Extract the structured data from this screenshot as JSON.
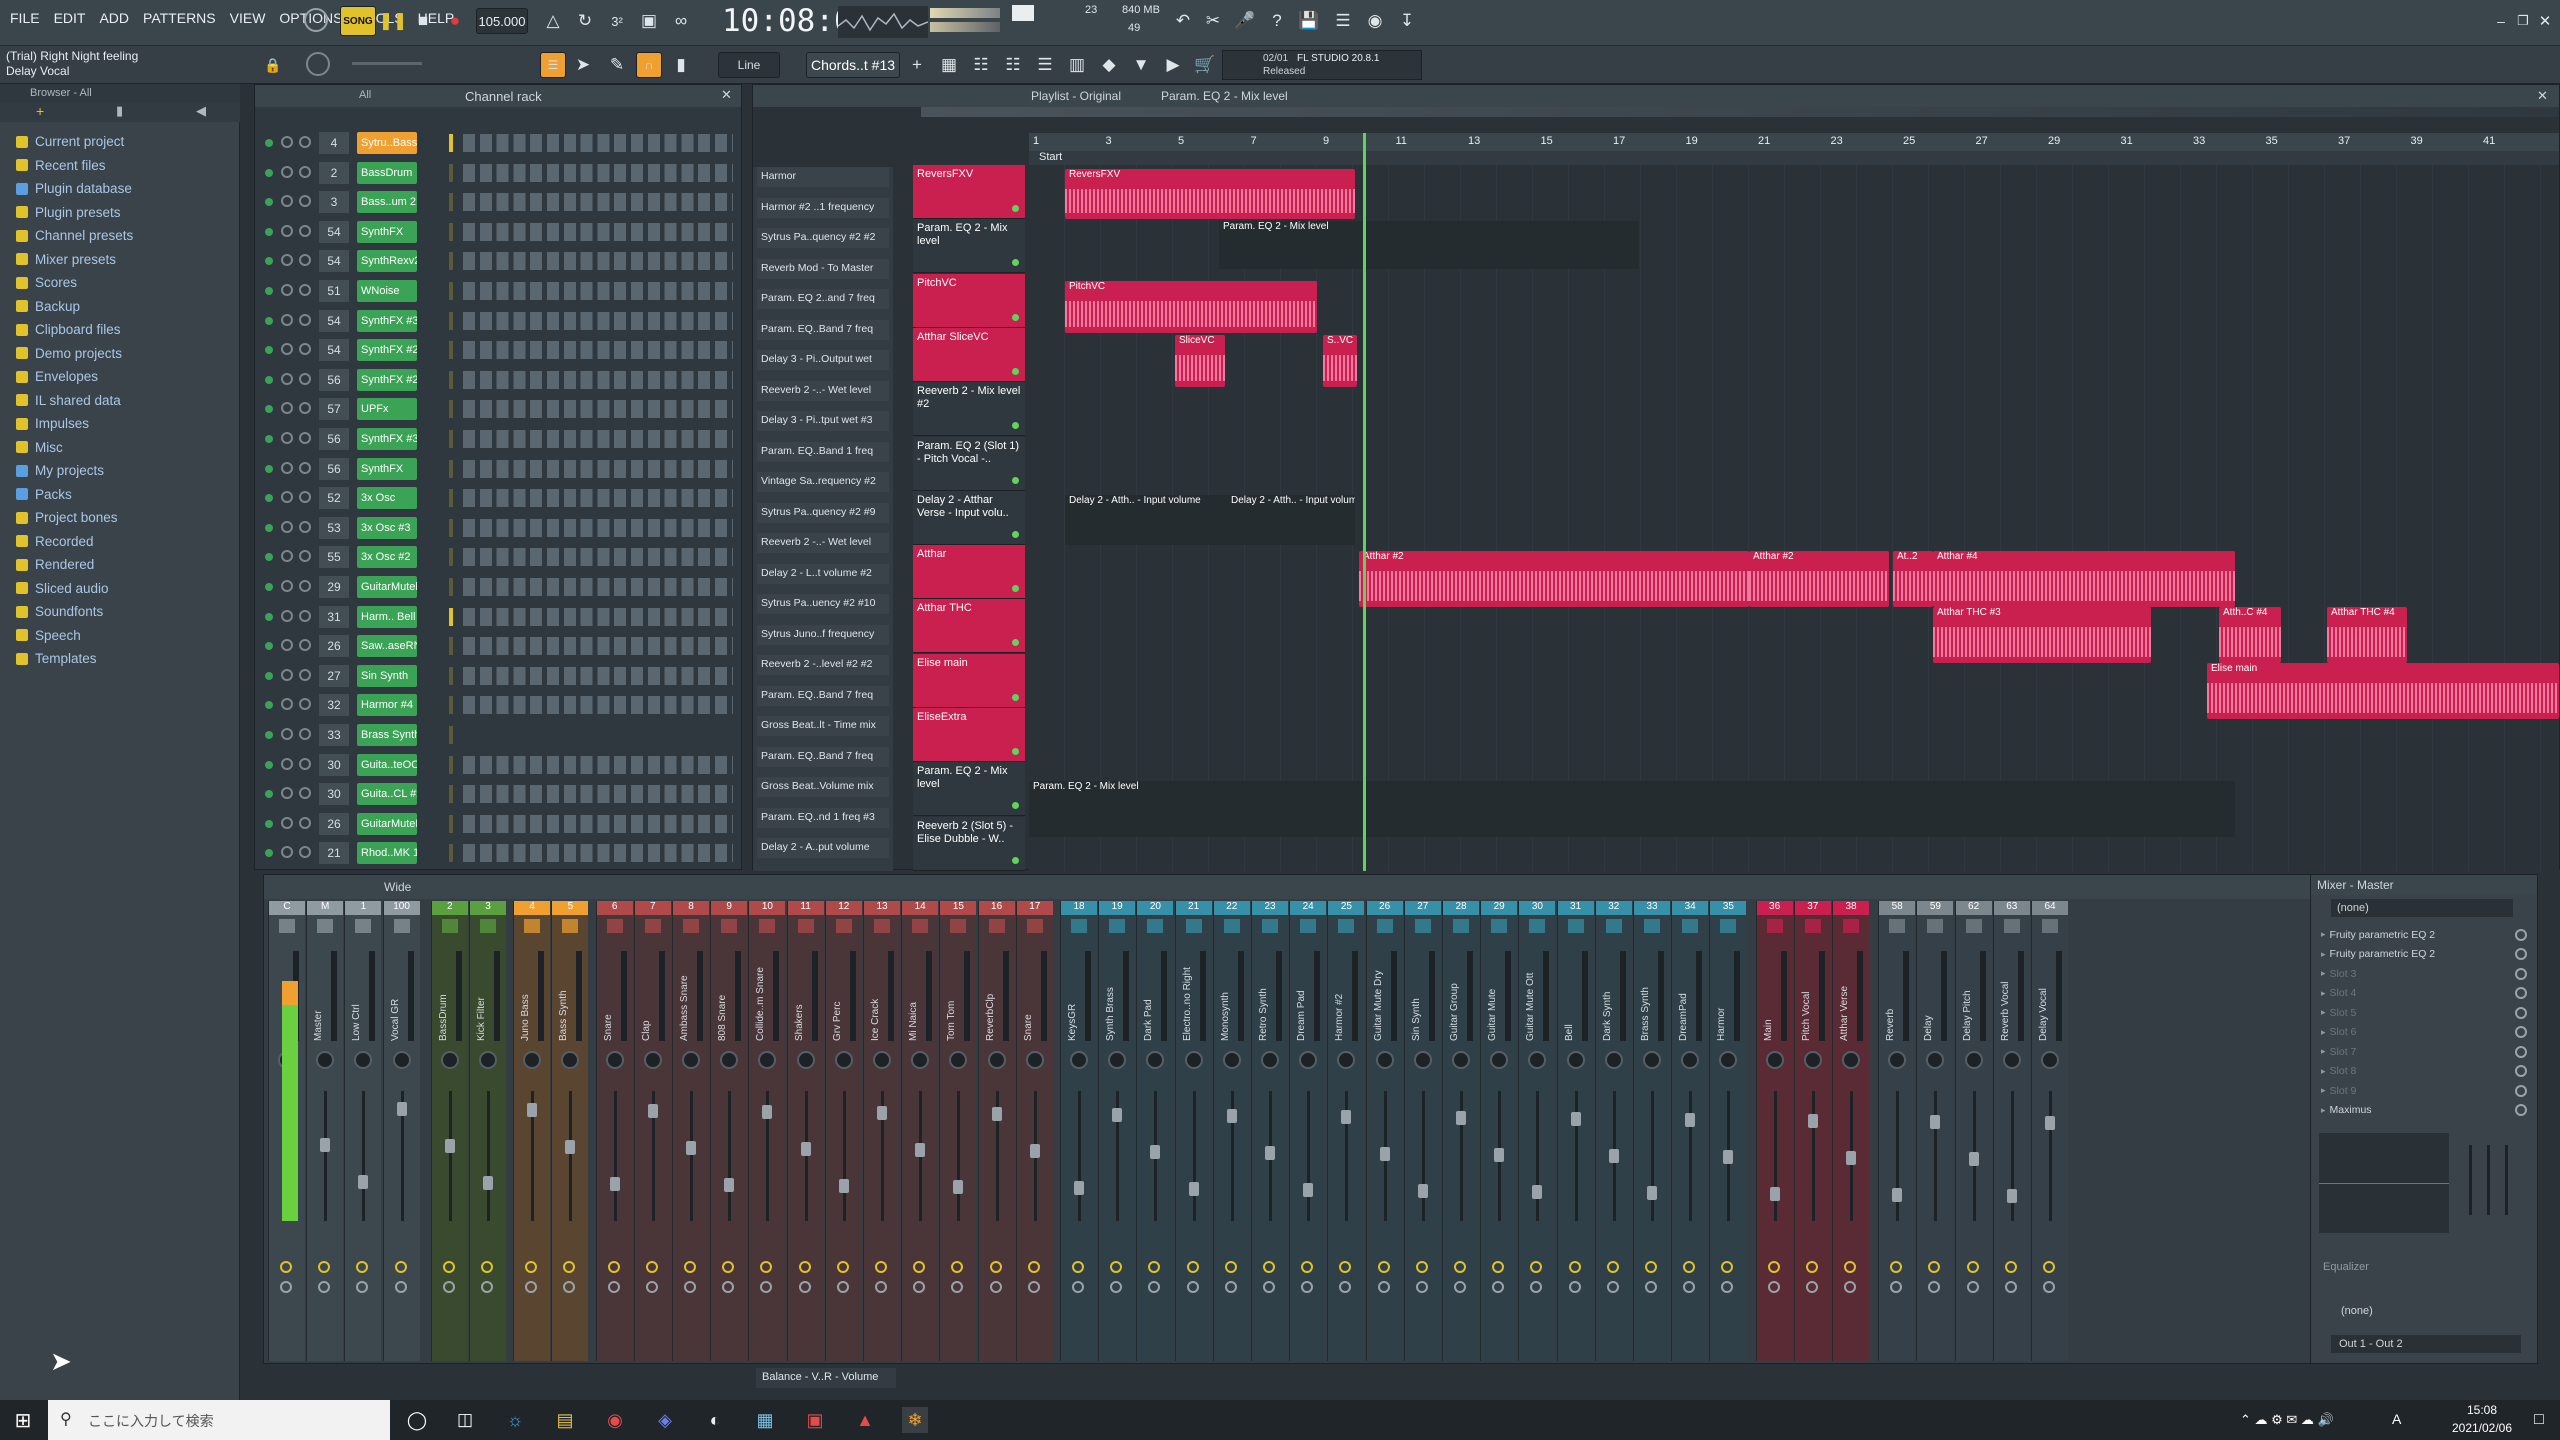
{
  "menu": [
    "FILE",
    "EDIT",
    "ADD",
    "PATTERNS",
    "VIEW",
    "OPTIONS",
    "TOOLS",
    "HELP"
  ],
  "transport": {
    "mode": "SONG",
    "tempo": "105.000",
    "time": "10:08:03",
    "cpu": "23",
    "memory": "840 MB",
    "polyphony": "49"
  },
  "hint": {
    "line1": "(Trial) Right Night feeling",
    "line2": "Delay Vocal"
  },
  "toolbar": {
    "snap": "Line",
    "pattern": "Chords..t #13",
    "news_date": "02/01",
    "news_title": "FL STUDIO 20.8.1",
    "news_sub": "Released"
  },
  "browser": {
    "title": "Browser - All",
    "items": [
      "Current project",
      "Recent files",
      "Plugin database",
      "Plugin presets",
      "Channel presets",
      "Mixer presets",
      "Scores",
      "Backup",
      "Clipboard files",
      "Demo projects",
      "Envelopes",
      "IL shared data",
      "Impulses",
      "Misc",
      "My projects",
      "Packs",
      "Project bones",
      "Recorded",
      "Rendered",
      "Sliced audio",
      "Soundfonts",
      "Speech",
      "Templates"
    ]
  },
  "rack": {
    "title": "Channel rack",
    "filter": "All",
    "channels": [
      {
        "num": "4",
        "name": "Sytru..Bass #4"
      },
      {
        "num": "2",
        "name": "BassDrum"
      },
      {
        "num": "3",
        "name": "Bass..um 2"
      },
      {
        "num": "54",
        "name": "SynthFX"
      },
      {
        "num": "54",
        "name": "SynthRexv2"
      },
      {
        "num": "51",
        "name": "WNoise"
      },
      {
        "num": "54",
        "name": "SynthFX #3"
      },
      {
        "num": "54",
        "name": "SynthFX #2"
      },
      {
        "num": "56",
        "name": "SynthFX #2"
      },
      {
        "num": "57",
        "name": "UPFx"
      },
      {
        "num": "56",
        "name": "SynthFX #3"
      },
      {
        "num": "56",
        "name": "SynthFX"
      },
      {
        "num": "52",
        "name": "3x Osc"
      },
      {
        "num": "53",
        "name": "3x Osc #3"
      },
      {
        "num": "55",
        "name": "3x Osc #2"
      },
      {
        "num": "29",
        "name": "GuitarMutel"
      },
      {
        "num": "31",
        "name": "Harm.. Bell"
      },
      {
        "num": "26",
        "name": "Saw..aseRN"
      },
      {
        "num": "27",
        "name": "Sin Synth"
      },
      {
        "num": "32",
        "name": "Harmor #4"
      },
      {
        "num": "33",
        "name": "Brass Synth"
      },
      {
        "num": "30",
        "name": "Guita..teOCL"
      },
      {
        "num": "30",
        "name": "Guita..CL #2"
      },
      {
        "num": "26",
        "name": "GuitarMuteR"
      },
      {
        "num": "21",
        "name": "Rhod..MK 1"
      }
    ]
  },
  "playlist": {
    "title": "Playlist - Original",
    "subtitle": "Param. EQ 2 - Mix level",
    "start_marker": "Start",
    "bar_numbers": [
      "1",
      "3",
      "5",
      "7",
      "9",
      "11",
      "13",
      "15",
      "17",
      "19",
      "21",
      "23",
      "25",
      "27",
      "29",
      "31",
      "33",
      "35",
      "37",
      "39",
      "41"
    ],
    "picker": [
      "Harmor",
      "Harmor #2 ..1 frequency",
      "Sytrus Pa..quency #2 #2",
      "Reverb Mod - To Master",
      "Param. EQ 2..and 7 freq",
      "Param. EQ..Band 7 freq",
      "Delay 3 - Pi..Output wet",
      "Reeverb 2 -..- Wet level",
      "Delay 3 - Pi..tput wet #3",
      "Param. EQ..Band 1 freq",
      "Vintage Sa..requency #2",
      "Sytrus Pa..quency #2 #9",
      "Reeverb 2 -..- Wet level",
      "Delay 2 - L..t volume #2",
      "Sytrus Pa..uency #2 #10",
      "Sytrus Juno..f frequency",
      "Reeverb 2 -..level #2 #2",
      "Param. EQ..Band 7 freq",
      "Gross Beat..lt - Time mix",
      "Param. EQ..Band 7 freq",
      "Gross Beat..Volume mix",
      "Param. EQ..nd 1 freq #3",
      "Delay 2 - A..put volume",
      "Balance - V..R - Volume"
    ],
    "tracks": [
      {
        "name": "ReversFXV"
      },
      {
        "name": "Param. EQ 2 - Mix level"
      },
      {
        "name": "PitchVC"
      },
      {
        "name": "Atthar SliceVC"
      },
      {
        "name": "Reeverb 2 - Mix level #2"
      },
      {
        "name": "Param. EQ 2 (Slot 1) - Pitch Vocal -.."
      },
      {
        "name": "Delay 2 - Atthar Verse - Input volu.."
      },
      {
        "name": "Atthar"
      },
      {
        "name": "Atthar THC"
      },
      {
        "name": "Elise main"
      },
      {
        "name": "EliseExtra"
      },
      {
        "name": "Param. EQ 2 - Mix level"
      },
      {
        "name": "Reeverb 2 (Slot 5) - Elise Dubble - W.."
      }
    ],
    "clips": {
      "c1": "ReversFXV",
      "c2": "Param. EQ 2 - Mix level",
      "c3": "PitchVC",
      "c4": "SliceVC",
      "c5": "S..VC",
      "c6": "Delay 2 - Atth.. - Input volume",
      "c7": "Delay 2 - Atth.. - Input volume",
      "c8": "Atthar #2",
      "c9": "Atthar #2",
      "c10": "At..2",
      "c11": "Atthar #4",
      "c12": "Atthar THC #3",
      "c13": "Atth..C #4",
      "c14": "Atthar THC #4",
      "c15": "Elise main",
      "c16": "Param. EQ 2 - Mix level"
    }
  },
  "mixer": {
    "title": "Mixer - Master",
    "width_mode": "Wide",
    "strips": [
      {
        "num": "C",
        "name": ""
      },
      {
        "num": "M",
        "name": "Master"
      },
      {
        "num": "1",
        "name": "Low Ctrl"
      },
      {
        "num": "100",
        "name": "Vocal GR"
      },
      {
        "num": "2",
        "name": "BassDrum"
      },
      {
        "num": "3",
        "name": "Kick Filter"
      },
      {
        "num": "4",
        "name": "Juno Bass"
      },
      {
        "num": "5",
        "name": "Bass Synth"
      },
      {
        "num": "6",
        "name": "Snare"
      },
      {
        "num": "7",
        "name": "Clap"
      },
      {
        "num": "8",
        "name": "Ambass Snare"
      },
      {
        "num": "9",
        "name": "808 Snare"
      },
      {
        "num": "10",
        "name": "Collide..m Snare"
      },
      {
        "num": "11",
        "name": "Shakers"
      },
      {
        "num": "12",
        "name": "Grv Perc"
      },
      {
        "num": "13",
        "name": "Ice Crack"
      },
      {
        "num": "14",
        "name": "Mi Naica"
      },
      {
        "num": "15",
        "name": "Tom Tom"
      },
      {
        "num": "16",
        "name": "ReverbClp"
      },
      {
        "num": "17",
        "name": "Snare"
      },
      {
        "num": "18",
        "name": "KeysGR"
      },
      {
        "num": "19",
        "name": "Synth Brass"
      },
      {
        "num": "20",
        "name": "Dark Pad"
      },
      {
        "num": "21",
        "name": "Electro..no Right"
      },
      {
        "num": "22",
        "name": "Monosynth"
      },
      {
        "num": "23",
        "name": "Retro Synth"
      },
      {
        "num": "24",
        "name": "Dream Pad"
      },
      {
        "num": "25",
        "name": "Harmor #2"
      },
      {
        "num": "26",
        "name": "Guitar Mute Dry"
      },
      {
        "num": "27",
        "name": "Sin Synth"
      },
      {
        "num": "28",
        "name": "Guitar Group"
      },
      {
        "num": "29",
        "name": "Guitar Mute"
      },
      {
        "num": "30",
        "name": "Guitar Mute Ott"
      },
      {
        "num": "31",
        "name": "Bell"
      },
      {
        "num": "32",
        "name": "Dark Synth"
      },
      {
        "num": "33",
        "name": "Brass Synth"
      },
      {
        "num": "34",
        "name": "DreamPad"
      },
      {
        "num": "35",
        "name": "Harmor"
      },
      {
        "num": "36",
        "name": "Main"
      },
      {
        "num": "37",
        "name": "Pitch Vocal"
      },
      {
        "num": "38",
        "name": "Atthar Verse"
      },
      {
        "num": "58",
        "name": "Reverb"
      },
      {
        "num": "59",
        "name": "Delay"
      },
      {
        "num": "62",
        "name": "Delay Pitch"
      },
      {
        "num": "63",
        "name": "Reverb Vocal"
      },
      {
        "num": "64",
        "name": "Delay Vocal"
      }
    ],
    "master_panel": {
      "input": "(none)",
      "slots": [
        "Fruity parametric EQ 2",
        "Fruity parametric EQ 2",
        "Slot 3",
        "Slot 4",
        "Slot 5",
        "Slot 6",
        "Slot 7",
        "Slot 8",
        "Slot 9",
        "Maximus"
      ],
      "eq_label": "Equalizer",
      "output_none": "(none)",
      "output": "Out 1 - Out 2"
    }
  },
  "taskbar": {
    "search_placeholder": "ここに入力して検索",
    "clock_time": "15:08",
    "clock_date": "2021/02/06",
    "ime": "A"
  },
  "colors": {
    "green": "#3aa356",
    "pink": "#e8356f",
    "clip_pink": "#c9204f",
    "orange": "#f0a030",
    "teal": "#35a0b0"
  }
}
